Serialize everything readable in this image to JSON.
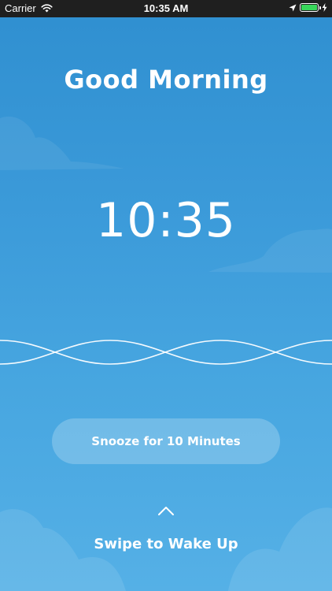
{
  "status_bar": {
    "carrier": "Carrier",
    "time": "10:35 AM",
    "battery_level": 1.0,
    "icons": [
      "wifi-icon",
      "location-arrow-icon",
      "battery-icon",
      "charging-bolt-icon"
    ]
  },
  "alarm": {
    "greeting": "Good Morning",
    "time": "10:35",
    "snooze_label": "Snooze for 10 Minutes",
    "swipe_label": "Swipe to Wake Up"
  },
  "colors": {
    "background_top": "#2f8fd0",
    "background_bottom": "#55b0e6",
    "text": "#ffffff",
    "battery": "#38d65a"
  }
}
